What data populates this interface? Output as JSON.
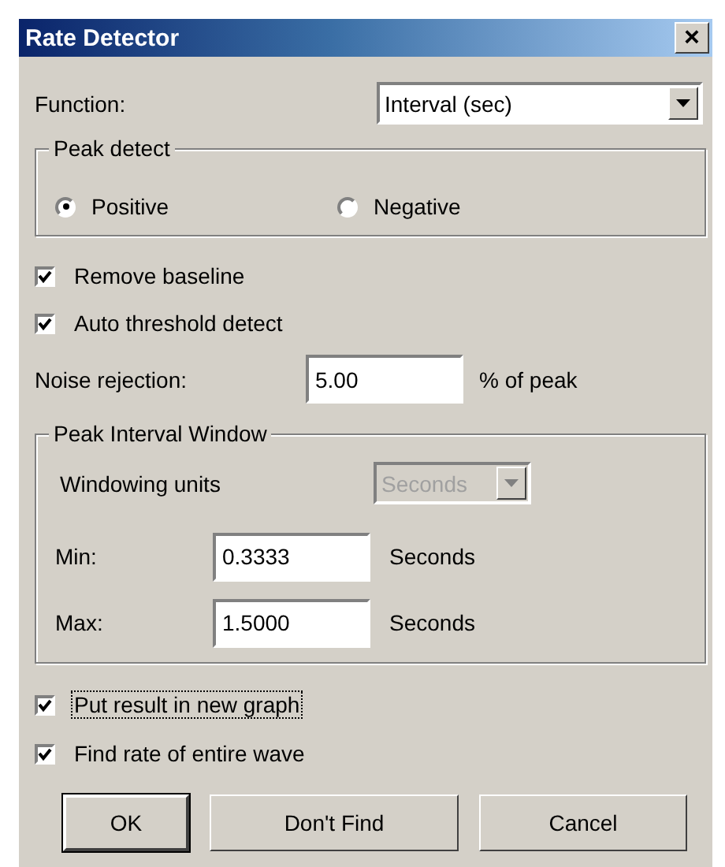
{
  "window": {
    "title": "Rate Detector",
    "close": "×"
  },
  "function": {
    "label": "Function:",
    "value": "Interval (sec)"
  },
  "peak_detect": {
    "title": "Peak detect",
    "options": [
      {
        "label": "Positive",
        "selected": true
      },
      {
        "label": "Negative",
        "selected": false
      }
    ]
  },
  "options_top": [
    {
      "label": "Remove baseline",
      "checked": true,
      "focused": false
    },
    {
      "label": "Auto threshold detect",
      "checked": true,
      "focused": false
    }
  ],
  "noise": {
    "label": "Noise rejection:",
    "value": "5.00",
    "unit": "% of peak"
  },
  "interval_window": {
    "title": "Peak Interval Window",
    "units_label": "Windowing units",
    "units_value": "Seconds",
    "units_disabled": true,
    "fields": [
      {
        "label": "Min:",
        "value": "0.3333",
        "unit": "Seconds"
      },
      {
        "label": "Max:",
        "value": "1.5000",
        "unit": "Seconds"
      }
    ]
  },
  "options_bottom": [
    {
      "label": "Put result in new graph",
      "checked": true,
      "focused": true
    },
    {
      "label": "Find rate of entire wave",
      "checked": true,
      "focused": false
    }
  ],
  "buttons": [
    {
      "label": "OK",
      "default": true
    },
    {
      "label": "Don't Find",
      "default": false
    },
    {
      "label": "Cancel",
      "default": false
    }
  ]
}
